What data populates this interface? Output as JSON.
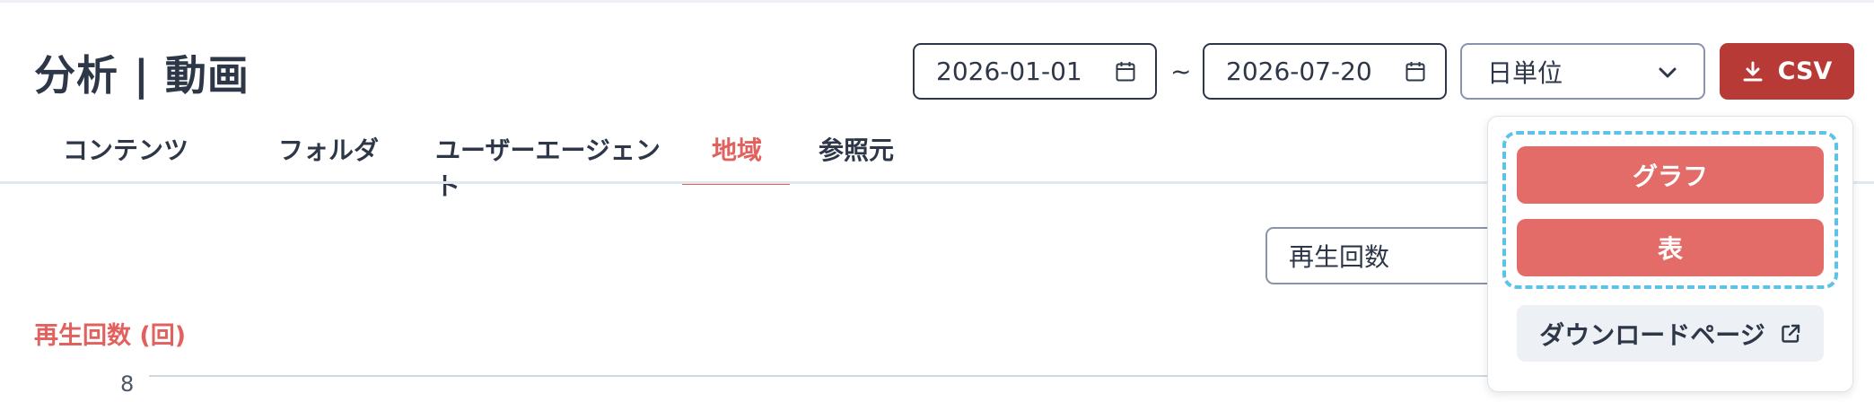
{
  "page": {
    "title": "分析 | 動画"
  },
  "filters": {
    "start_date": "2026-01-01",
    "separator": "~",
    "end_date": "2026-07-20",
    "unit_select": {
      "selected": "日単位"
    },
    "csv_button": {
      "label": "CSV"
    }
  },
  "tabs": [
    {
      "label": "コンテンツ",
      "active": false
    },
    {
      "label": "フォルダ",
      "active": false
    },
    {
      "label": "ユーザーエージェント",
      "active": false
    },
    {
      "label": "地域",
      "active": true
    },
    {
      "label": "参照元",
      "active": false
    }
  ],
  "metric_select": {
    "selected": "再生回数"
  },
  "chart": {
    "ylabel": "再生回数 (回)",
    "visible_tick": "8"
  },
  "csv_menu": {
    "graph_label": "グラフ",
    "table_label": "表",
    "download_page_label": "ダウンロードページ"
  },
  "colors": {
    "accent": "#e0615d",
    "csv_button": "#b83a36",
    "menu_button": "#e36c68",
    "highlight_dash": "#5cc3e8",
    "text": "#2d3748"
  },
  "icons": {
    "date_picker": "calendar-icon",
    "unit_select": "chevron-down-icon",
    "csv": "download-icon",
    "download_page": "external-link-icon"
  }
}
